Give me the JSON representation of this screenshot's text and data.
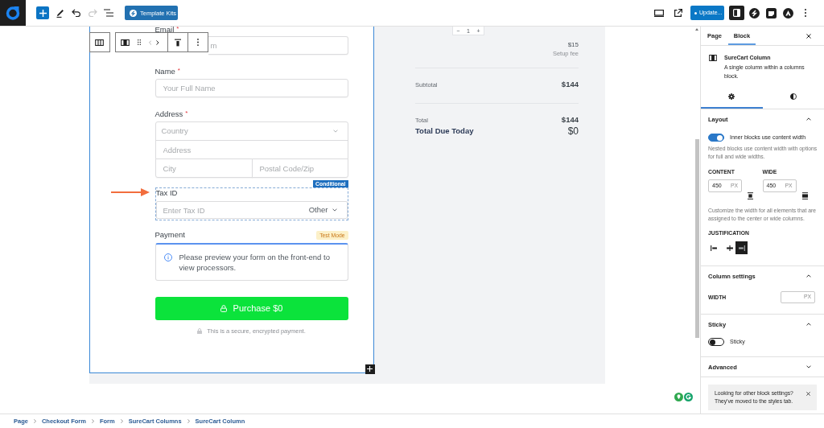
{
  "top_bar": {
    "undo": {
      "disabled": false
    },
    "redo": {
      "disabled": true
    },
    "template_kits_button": "Template Kits",
    "update_button": "Update...",
    "settings_toggle": {
      "on": true
    }
  },
  "block_toolbar": {
    "move_left": {
      "disabled": true
    },
    "move_right": {
      "disabled": false
    }
  },
  "form": {
    "fields": [
      {
        "kind": "text",
        "label": "Email",
        "required_mark": "*",
        "placeholder": "m"
      },
      {
        "kind": "text",
        "label": "Name",
        "required_mark": "*",
        "placeholder": "Your Full Name"
      },
      {
        "kind": "address",
        "label": "Address",
        "required_mark": "*",
        "country_placeholder": "Country",
        "address_placeholder": "Address",
        "city_placeholder": "City",
        "postal_code_placeholder": "Postal Code/Zip"
      },
      {
        "kind": "tax_id",
        "label": "Tax ID",
        "badge": "Conditional",
        "placeholder": "Enter Tax ID",
        "id_type": "Other"
      },
      {
        "kind": "payment",
        "label": "Payment",
        "badge": "Test Mode",
        "notice": "Please preview your form on the front-end to view processors."
      }
    ],
    "submit_button": "Purchase $0",
    "secure_note": "This is a secure, encrypted payment."
  },
  "order_summary": {
    "quantity": {
      "decrease": "−",
      "value": "1",
      "increase": "+"
    },
    "fee": {
      "amount": "$15",
      "label": "Setup fee"
    },
    "rows": [
      {
        "kind": "subtotal",
        "label": "Subtotal",
        "value": "$144"
      },
      {
        "kind": "total",
        "label": "Total",
        "value": "$144"
      },
      {
        "kind": "amount_due",
        "label": "Total Due Today",
        "value": "$0"
      }
    ]
  },
  "sidebar": {
    "tabs": [
      {
        "label": "Page",
        "selected": false
      },
      {
        "label": "Block",
        "selected": true
      }
    ],
    "block": {
      "title": "SureCart Column",
      "description": "A single column within a columns block."
    },
    "panel_tabs": [
      {
        "kind": "settings",
        "selected": true
      },
      {
        "kind": "styles",
        "selected": false
      }
    ],
    "layout": {
      "title": "Layout",
      "expanded": true,
      "toggle": {
        "label": "Inner blocks use content width",
        "on": true
      },
      "toggle_help": "Nested blocks use content width with options for full and wide widths.",
      "widths": [
        {
          "kind": "content",
          "label": "CONTENT",
          "value": "450",
          "unit": "PX"
        },
        {
          "kind": "wide",
          "label": "WIDE",
          "value": "450",
          "unit": "PX"
        }
      ],
      "widths_help": "Customize the width for all elements that are assigned to the center or wide columns.",
      "justification": {
        "label": "JUSTIFICATION",
        "options": [
          {
            "kind": "left",
            "selected": false
          },
          {
            "kind": "center",
            "selected": false
          },
          {
            "kind": "right",
            "selected": true
          }
        ]
      }
    },
    "column_settings": {
      "title": "Column settings",
      "expanded": true,
      "width": {
        "label": "WIDTH",
        "unit": "PX"
      }
    },
    "sticky": {
      "title": "Sticky",
      "expanded": true,
      "toggle": {
        "label": "Sticky",
        "on": false
      }
    },
    "advanced": {
      "title": "Advanced",
      "expanded": false
    },
    "notice": "Looking for other block settings? They've moved to the styles tab."
  },
  "breadcrumbs": [
    "Page",
    "Checkout Form",
    "Form",
    "SureCart Columns",
    "SureCart Column"
  ]
}
